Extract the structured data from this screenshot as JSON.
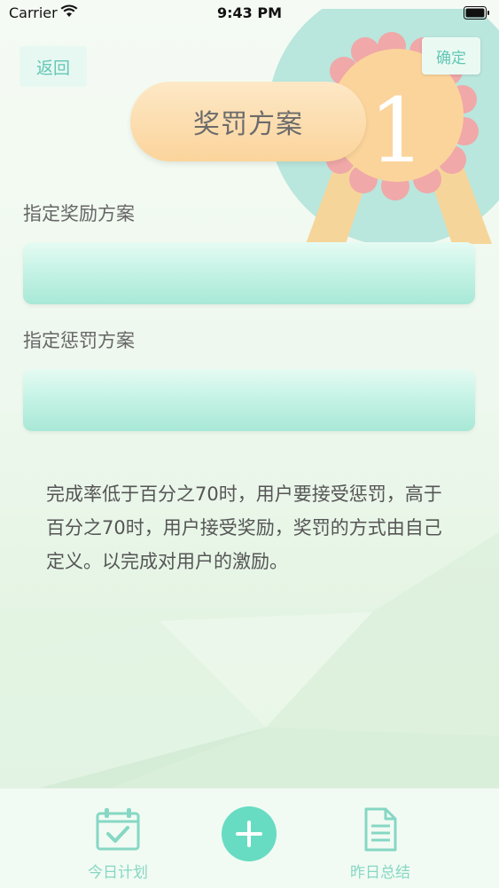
{
  "status_bar": {
    "carrier": "Carrier",
    "time": "9:43 PM"
  },
  "nav": {
    "back_label": "返回",
    "confirm_label": "确定"
  },
  "medal": {
    "number": "1"
  },
  "title": "奖罚方案",
  "form": {
    "reward_label": "指定奖励方案",
    "reward_value": "",
    "penalty_label": "指定惩罚方案",
    "penalty_value": ""
  },
  "description": "完成率低于百分之70时，用户要接受惩罚，高于百分之70时，用户接受奖励，奖罚的方式由自己定义。以完成对用户的激励。",
  "tabbar": {
    "today_label": "今日计划",
    "yesterday_label": "昨日总结"
  },
  "colors": {
    "accent": "#67dcc2",
    "title_pill": "#fbd49b",
    "field": "#a8e8d6"
  }
}
